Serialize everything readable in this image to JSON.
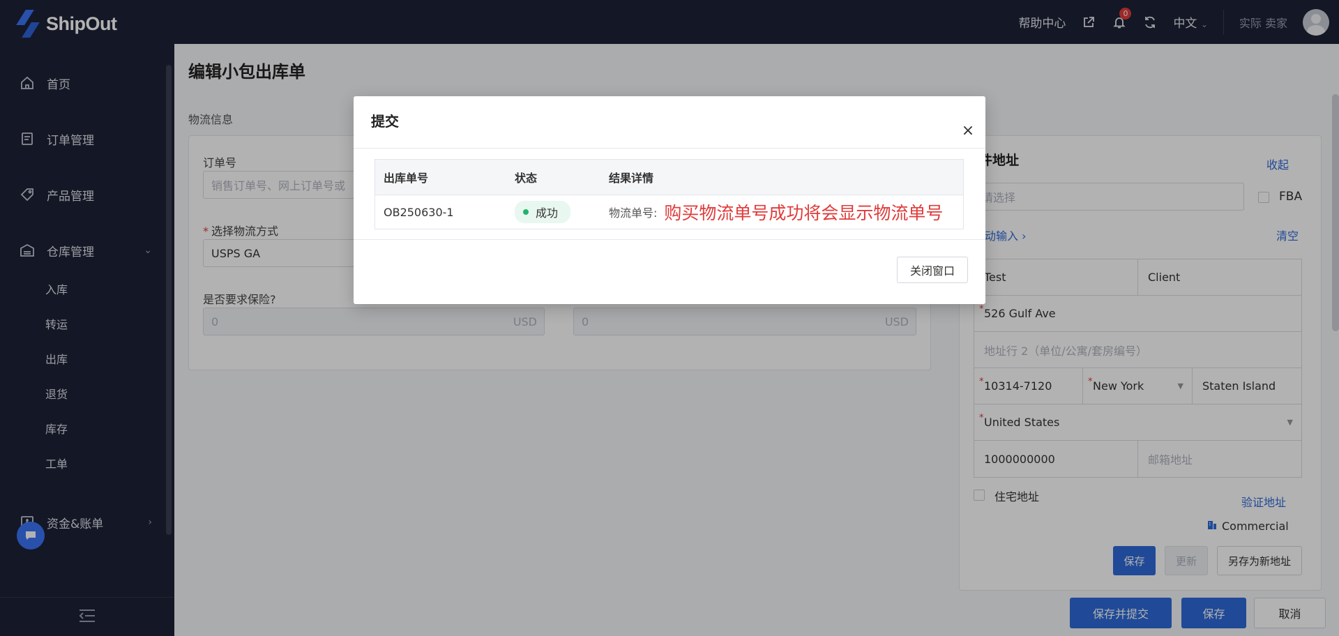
{
  "app": {
    "logo_text": "ShipOut"
  },
  "topbar": {
    "help": "帮助中心",
    "notifications_count": "0",
    "language": "中文",
    "language_arrow": "⌄",
    "user_name": "实际 卖家"
  },
  "sidebar": {
    "items": [
      {
        "label": "首页",
        "icon": "home-icon"
      },
      {
        "label": "订单管理",
        "icon": "order-icon"
      },
      {
        "label": "产品管理",
        "icon": "tag-icon"
      },
      {
        "label": "仓库管理",
        "icon": "warehouse-icon"
      },
      {
        "label": "资金&账单",
        "icon": "bill-icon"
      }
    ],
    "warehouse_sub": [
      "入库",
      "转运",
      "出库",
      "退货",
      "库存",
      "工单"
    ],
    "partial_item": "..."
  },
  "page": {
    "title": "编辑小包出库单",
    "section_label": "物流信息"
  },
  "logistics": {
    "order_no_label": "订单号",
    "order_no_placeholder": "销售订单号、网上订单号或",
    "method_label": "选择物流方式",
    "method_value": "USPS GA",
    "insurance_label": "是否要求保险?",
    "insurance_value": "0",
    "insurance_unit": "USD",
    "second_value": "0",
    "second_unit": "USD"
  },
  "address": {
    "title": "件地址",
    "collapse": "收起",
    "select_placeholder": "请选择",
    "fba": "FBA",
    "manual_input": "动输入 ›",
    "clear": "清空",
    "first_name": "Test",
    "last_name": "Client",
    "line1": "526 Gulf Ave",
    "line2_placeholder": "地址行 2（单位/公寓/套房编号）",
    "zip": "10314-7120",
    "state": "New York",
    "city": "Staten Island",
    "country": "United States",
    "phone": "1000000000",
    "email_placeholder": "邮箱地址",
    "residential": "住宅地址",
    "verify": "验证地址",
    "commercial": "Commercial",
    "save": "保存",
    "update": "更新",
    "save_as_new": "另存为新地址"
  },
  "footer_actions": {
    "save_submit": "保存并提交",
    "save": "保存",
    "cancel": "取消"
  },
  "modal": {
    "title": "提交",
    "close_symbol": "×",
    "columns": [
      "出库单号",
      "状态",
      "结果详情"
    ],
    "row": {
      "outbound_no": "OB250630-1",
      "status": "成功",
      "detail_label": "物流单号:",
      "detail_note": "购买物流单号成功将会显示物流单号"
    },
    "close_window": "关闭窗口"
  },
  "colors": {
    "primary": "#2f6ad8",
    "success": "#20b36b",
    "danger": "#e03b3b",
    "nav_bg": "#1d2235"
  }
}
